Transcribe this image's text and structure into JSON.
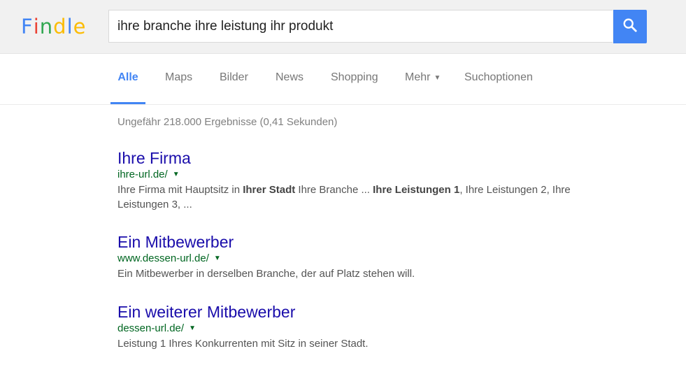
{
  "logo": {
    "letters": [
      {
        "char": "F",
        "color": "#4285f4"
      },
      {
        "char": "i",
        "color": "#ea4335"
      },
      {
        "char": "n",
        "color": "#34a853"
      },
      {
        "char": "d",
        "color": "#fbbc05"
      },
      {
        "char": "l",
        "color": "#4285f4"
      },
      {
        "char": "e",
        "color": "#fbbc05"
      }
    ]
  },
  "search": {
    "query": "ihre branche ihre leistung ihr produkt",
    "button_icon": "search-icon",
    "button_color": "#4285f4"
  },
  "tabs": [
    {
      "label": "Alle",
      "active": true
    },
    {
      "label": "Maps",
      "active": false
    },
    {
      "label": "Bilder",
      "active": false
    },
    {
      "label": "News",
      "active": false
    },
    {
      "label": "Shopping",
      "active": false
    },
    {
      "label": "Mehr",
      "active": false,
      "icon": "caret-down-icon"
    },
    {
      "label": "Suchoptionen",
      "active": false
    }
  ],
  "result_stats": "Ungefähr 218.000 Ergebnisse (0,41 Sekunden)",
  "results": [
    {
      "title": "Ihre Firma",
      "url": "ihre-url.de/",
      "snippet": [
        {
          "text": "Ihre Firma mit Hauptsitz in ",
          "bold": false
        },
        {
          "text": "Ihrer Stadt",
          "bold": true
        },
        {
          "text": " Ihre Branche ... ",
          "bold": false
        },
        {
          "text": "Ihre Leistungen 1",
          "bold": true
        },
        {
          "text": ", Ihre Leistungen 2, Ihre Leistungen 3, ...",
          "bold": false
        }
      ]
    },
    {
      "title": "Ein Mitbewerber",
      "url": "www.dessen-url.de/",
      "snippet": [
        {
          "text": "Ein Mitbewerber in derselben Branche, der auf Platz stehen will.",
          "bold": false
        }
      ]
    },
    {
      "title": "Ein weiterer Mitbewerber",
      "url": "dessen-url.de/",
      "snippet": [
        {
          "text": "Leistung 1 Ihres Konkurrenten mit Sitz in seiner Stadt.",
          "bold": false
        }
      ]
    }
  ]
}
